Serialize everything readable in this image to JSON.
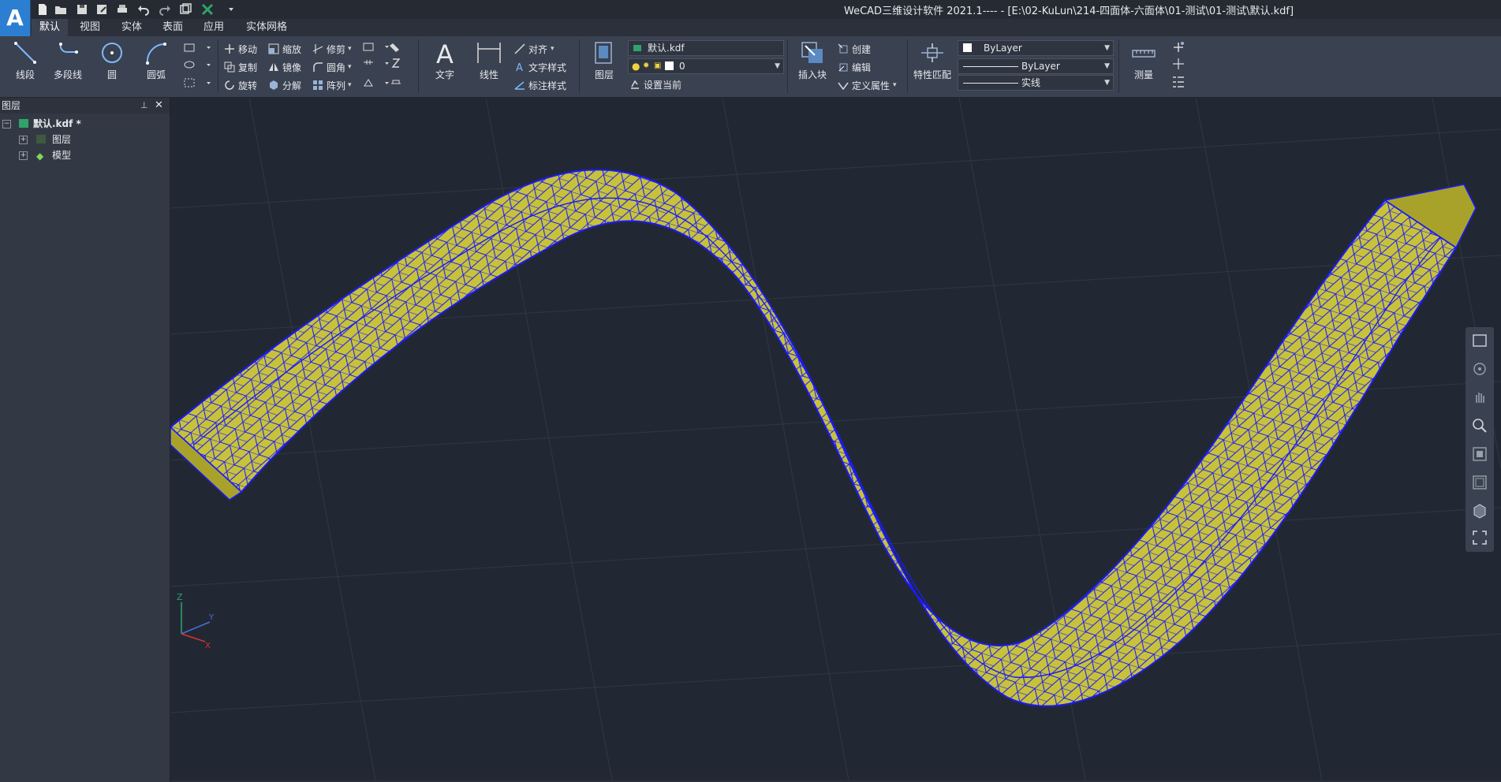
{
  "app": {
    "logo_letter": "A",
    "title": "WeCAD三维设计软件 2021.1---- - [E:\\02-KuLun\\214-四面体-六面体\\01-测试\\01-测试\\默认.kdf]"
  },
  "quick_access": [
    "new-file-icon",
    "open-folder-icon",
    "save-icon",
    "save-as-icon",
    "print-icon",
    "undo-icon",
    "redo-icon",
    "window-icon",
    "excel-icon",
    "customize-dropdown-icon"
  ],
  "menu_tabs": [
    "默认",
    "视图",
    "实体",
    "表面",
    "应用",
    "实体网格"
  ],
  "ribbon": {
    "draw": {
      "line": "线段",
      "polyline": "多段线",
      "circle": "圆",
      "arc": "圆弧"
    },
    "modify": {
      "move": "移动",
      "copy": "复制",
      "rotate": "旋转",
      "scale": "缩放",
      "mirror": "镜像",
      "explode": "分解",
      "trim": "修剪",
      "fillet": "圆角",
      "array": "阵列"
    },
    "annotation": {
      "text": "文字",
      "linear": "线性",
      "align": "对齐",
      "text_style": "文字样式",
      "dim_style": "标注样式"
    },
    "layers": {
      "layer_btn": "图层",
      "file_name": "默认.kdf",
      "current_layer": "0",
      "set_current": "设置当前"
    },
    "block": {
      "insert": "插入块",
      "create": "创建",
      "edit": "编辑",
      "define_attr": "定义属性"
    },
    "properties": {
      "match": "特性匹配",
      "color": "ByLayer",
      "linetype": "ByLayer",
      "lineweight": "实线"
    },
    "utilities": {
      "measure": "测量"
    }
  },
  "layer_panel": {
    "title": "图层",
    "root": "默认.kdf *",
    "children": [
      "图层",
      "模型"
    ]
  },
  "viewport": {
    "axis_labels": {
      "z": "Z",
      "y": "Y",
      "x": "X"
    },
    "colors": {
      "background": "#222833",
      "mesh_fill": "#c8c23a",
      "mesh_edge": "#1a1aff",
      "grid": "#2f3746"
    }
  }
}
